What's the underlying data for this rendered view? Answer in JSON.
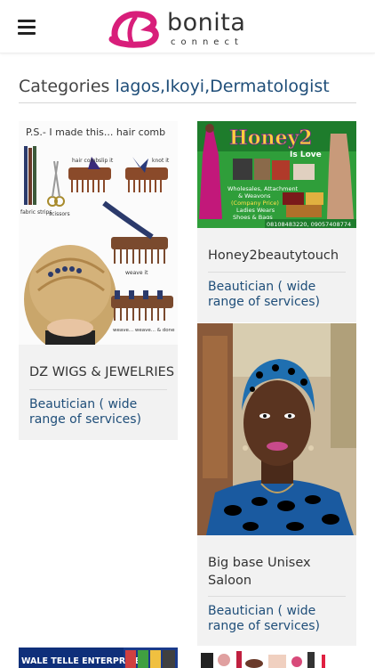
{
  "brand": {
    "name": "bonita",
    "tagline": "connect",
    "color": "#d81e7a"
  },
  "heading": {
    "prefix": "Categories",
    "path": "lagos,Ikoyi,Dermatologist"
  },
  "listings": [
    {
      "title": "DZ WIGS & JEWELRIES",
      "category": "Beautician ( wide range of services)",
      "image": {
        "caption": "P.S.- I made this... hair comb",
        "labels": [
          "hair comb",
          "slip it",
          "knot it",
          "scissors",
          "fabric strips",
          "weave it",
          "weave... weave... & done"
        ]
      }
    },
    {
      "title": "Honey2beautytouch",
      "category": "Beautician ( wide range of services)",
      "image": {
        "headline": "Honey2",
        "sub": "Is Love",
        "lines": [
          "Wholesales, Attachment",
          "& Weavons",
          "(Company Price)",
          "Ladies Wears",
          "Shoes & Bags"
        ],
        "phones": "08108483220, 09057408774"
      }
    },
    {
      "title": "Big base Unisex Saloon",
      "category": "Beautician ( wide range of services)",
      "image": {}
    }
  ],
  "partial_listings": [
    {
      "banner": "WALE TELLE ENTERPRISES"
    }
  ]
}
